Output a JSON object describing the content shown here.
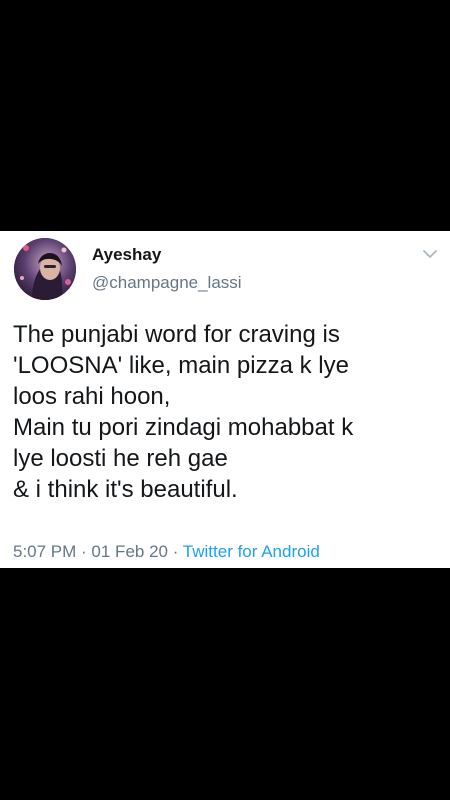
{
  "tweet": {
    "author": {
      "display_name": "Ayeshay",
      "handle": "@champagne_lassi"
    },
    "text_lines": [
      "The punjabi word for craving is",
      "'LOOSNA' like, main pizza k lye",
      "loos rahi hoon,",
      "Main tu pori zindagi mohabbat k",
      "lye loosti he reh gae",
      "& i think it's beautiful."
    ],
    "time": "5:07 PM",
    "separator": " · ",
    "date": "01 Feb 20",
    "source": "Twitter for Android",
    "menu_icon": "chevron-down-icon"
  },
  "colors": {
    "background": "#000000",
    "card": "#ffffff",
    "text": "#14171a",
    "secondary_text": "#657786",
    "link": "#1da1f2"
  }
}
